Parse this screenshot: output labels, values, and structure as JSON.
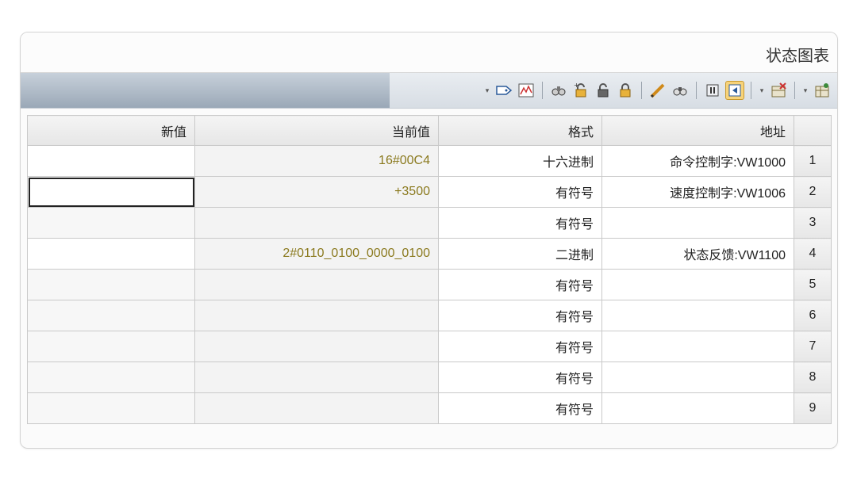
{
  "window": {
    "title": "状态图表"
  },
  "toolbar": {
    "icons": [
      "insert-table-icon",
      "dropdown-caret",
      "delete-table-icon",
      "dropdown-caret",
      "separator",
      "single-read-icon",
      "pause-icon",
      "separator",
      "binoculars-icon",
      "pencil-write-icon",
      "separator",
      "lock-icon",
      "unlock-icon",
      "unlock-all-icon",
      "force-icon",
      "separator",
      "trend-chart-icon",
      "tag-icon",
      "dropdown-caret"
    ]
  },
  "table": {
    "headers": {
      "address": "地址",
      "format": "格式",
      "current_value": "当前值",
      "new_value": "新值"
    },
    "rows": [
      {
        "num": "1",
        "address": "命令控制字:VW1000",
        "format": "十六进制",
        "current_value": "16#00C4",
        "new_value": ""
      },
      {
        "num": "2",
        "address": "速度控制字:VW1006",
        "format": "有符号",
        "current_value": "+3500",
        "new_value": ""
      },
      {
        "num": "3",
        "address": "",
        "format": "有符号",
        "current_value": "",
        "new_value": ""
      },
      {
        "num": "4",
        "address": "状态反馈:VW1100",
        "format": "二进制",
        "current_value": "2#0110_0100_0000_0100",
        "new_value": ""
      },
      {
        "num": "5",
        "address": "",
        "format": "有符号",
        "current_value": "",
        "new_value": ""
      },
      {
        "num": "6",
        "address": "",
        "format": "有符号",
        "current_value": "",
        "new_value": ""
      },
      {
        "num": "7",
        "address": "",
        "format": "有符号",
        "current_value": "",
        "new_value": ""
      },
      {
        "num": "8",
        "address": "",
        "format": "有符号",
        "current_value": "",
        "new_value": ""
      },
      {
        "num": "9",
        "address": "",
        "format": "有符号",
        "current_value": "",
        "new_value": ""
      }
    ],
    "selected_row": "2"
  }
}
